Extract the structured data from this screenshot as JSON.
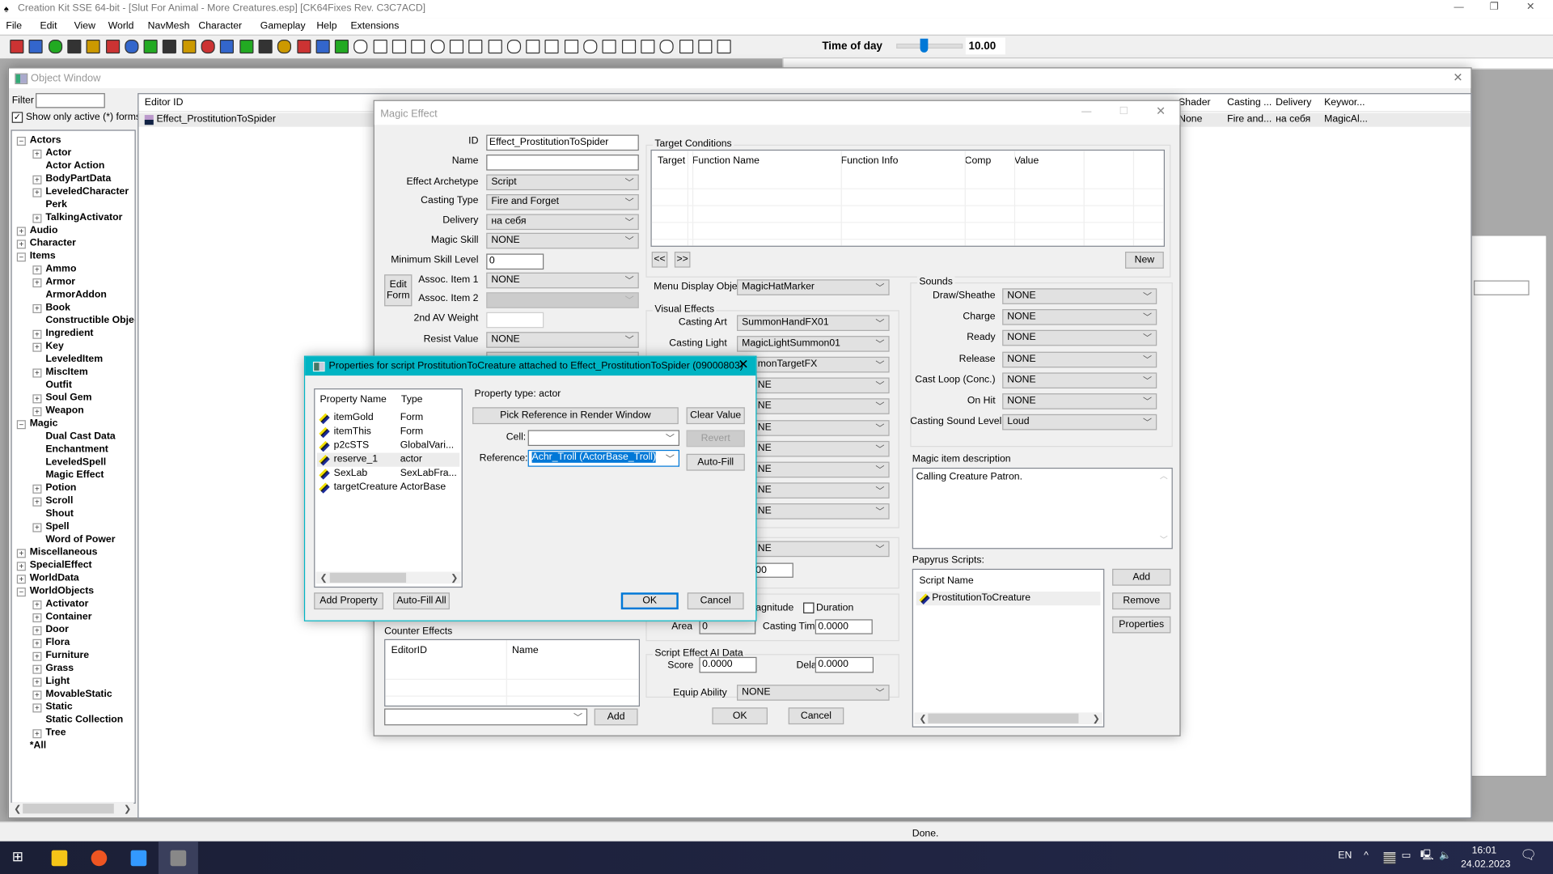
{
  "app": {
    "title": "Creation Kit SSE 64-bit - [Slut For Animal - More Creatures.esp] [CK64Fixes Rev. C3C7ACD]",
    "menu": [
      "File",
      "Edit",
      "View",
      "World",
      "NavMesh",
      "Character",
      "Gameplay",
      "Help",
      "Extensions"
    ],
    "toolbar_icons": [
      "open-icon",
      "save-icon",
      "pc-upload-icon",
      "preferences-icon",
      "undo-icon",
      "redo-icon",
      "render-box-icon",
      "marker-icon",
      "light-marker-icon",
      "world-icon",
      "landscape-icon",
      "havok-icon",
      "fx-icon",
      "bulb-icon",
      "sky-icon",
      "grass-icon",
      "speech-bubble-icon",
      "navmesh-icon",
      "view-box-icon",
      "view-m-icon",
      "view-circle-m-icon",
      "view-0-icon",
      "view-nb-icon",
      "view-h-icon",
      "view-cube-icon",
      "view-p-icon",
      "view-P-icon",
      "view-q-icon",
      "view-x-icon",
      "view-s-icon",
      "light-toggle-icon",
      "view-e-icon",
      "view-c-icon",
      "view-cc-icon",
      "view-circle-c-icon",
      "view-w-icon",
      "view-ww-icon",
      "view-circle-w-icon"
    ],
    "time_of_day_label": "Time of day",
    "time_of_day_value": "10.00",
    "time_of_day_fraction": 0.42,
    "status": "Done."
  },
  "object_window": {
    "title": "Object Window",
    "filter_label": "Filter",
    "filter_value": "",
    "show_active_label": "Show only active (*) forms",
    "show_active_checked": true,
    "tree": [
      {
        "label": "Actors",
        "level": 0,
        "box": "-"
      },
      {
        "label": "Actor",
        "level": 1,
        "box": "+"
      },
      {
        "label": "Actor Action",
        "level": 1,
        "box": ""
      },
      {
        "label": "BodyPartData",
        "level": 1,
        "box": "+"
      },
      {
        "label": "LeveledCharacter",
        "level": 1,
        "box": "+"
      },
      {
        "label": "Perk",
        "level": 1,
        "box": ""
      },
      {
        "label": "TalkingActivator",
        "level": 1,
        "box": "+"
      },
      {
        "label": "Audio",
        "level": 0,
        "box": "+"
      },
      {
        "label": "Character",
        "level": 0,
        "box": "+"
      },
      {
        "label": "Items",
        "level": 0,
        "box": "-"
      },
      {
        "label": "Ammo",
        "level": 1,
        "box": "+"
      },
      {
        "label": "Armor",
        "level": 1,
        "box": "+"
      },
      {
        "label": "ArmorAddon",
        "level": 1,
        "box": ""
      },
      {
        "label": "Book",
        "level": 1,
        "box": "+"
      },
      {
        "label": "Constructible Objec",
        "level": 1,
        "box": ""
      },
      {
        "label": "Ingredient",
        "level": 1,
        "box": "+"
      },
      {
        "label": "Key",
        "level": 1,
        "box": "+"
      },
      {
        "label": "LeveledItem",
        "level": 1,
        "box": ""
      },
      {
        "label": "MiscItem",
        "level": 1,
        "box": "+"
      },
      {
        "label": "Outfit",
        "level": 1,
        "box": ""
      },
      {
        "label": "Soul Gem",
        "level": 1,
        "box": "+"
      },
      {
        "label": "Weapon",
        "level": 1,
        "box": "+"
      },
      {
        "label": "Magic",
        "level": 0,
        "box": "-"
      },
      {
        "label": "Dual Cast Data",
        "level": 1,
        "box": ""
      },
      {
        "label": "Enchantment",
        "level": 1,
        "box": ""
      },
      {
        "label": "LeveledSpell",
        "level": 1,
        "box": ""
      },
      {
        "label": "Magic Effect",
        "level": 1,
        "box": ""
      },
      {
        "label": "Potion",
        "level": 1,
        "box": "+"
      },
      {
        "label": "Scroll",
        "level": 1,
        "box": "+"
      },
      {
        "label": "Shout",
        "level": 1,
        "box": ""
      },
      {
        "label": "Spell",
        "level": 1,
        "box": "+"
      },
      {
        "label": "Word of Power",
        "level": 1,
        "box": ""
      },
      {
        "label": "Miscellaneous",
        "level": 0,
        "box": "+"
      },
      {
        "label": "SpecialEffect",
        "level": 0,
        "box": "+"
      },
      {
        "label": "WorldData",
        "level": 0,
        "box": "+"
      },
      {
        "label": "WorldObjects",
        "level": 0,
        "box": "-"
      },
      {
        "label": "Activator",
        "level": 1,
        "box": "+"
      },
      {
        "label": "Container",
        "level": 1,
        "box": "+"
      },
      {
        "label": "Door",
        "level": 1,
        "box": "+"
      },
      {
        "label": "Flora",
        "level": 1,
        "box": "+"
      },
      {
        "label": "Furniture",
        "level": 1,
        "box": "+"
      },
      {
        "label": "Grass",
        "level": 1,
        "box": "+"
      },
      {
        "label": "Light",
        "level": 1,
        "box": "+"
      },
      {
        "label": "MovableStatic",
        "level": 1,
        "box": "+"
      },
      {
        "label": "Static",
        "level": 1,
        "box": "+"
      },
      {
        "label": "Static Collection",
        "level": 1,
        "box": ""
      },
      {
        "label": "Tree",
        "level": 1,
        "box": "+"
      },
      {
        "label": "*All",
        "level": 0,
        "box": "none"
      }
    ],
    "columns": {
      "editor_id": "Editor ID",
      "shader": "Shader",
      "casting": "Casting ...",
      "delivery": "Delivery",
      "keywords": "Keywor..."
    },
    "row": {
      "editor_id": "Effect_ProstitutionToSpider",
      "shader": "None",
      "casting": "Fire and...",
      "delivery": "на себя",
      "keywords": "MagicAl..."
    }
  },
  "magic_effect": {
    "title": "Magic Effect",
    "id_label": "ID",
    "id_value": "Effect_ProstitutionToSpider",
    "name_label": "Name",
    "name_value": "",
    "archetype_label": "Effect Archetype",
    "archetype_value": "Script",
    "casting_type_label": "Casting Type",
    "casting_type_value": "Fire and Forget",
    "delivery_label": "Delivery",
    "delivery_value": "на себя",
    "magic_skill_label": "Magic Skill",
    "magic_skill_value": "NONE",
    "min_skill_label": "Minimum Skill Level",
    "min_skill_value": "0",
    "edit_form_label": "Edit Form",
    "assoc1_label": "Assoc. Item 1",
    "assoc1_value": "NONE",
    "assoc2_label": "Assoc. Item 2",
    "assoc2_value": "",
    "av_weight_label": "2nd AV Weight",
    "av_weight_value": "",
    "resist_label": "Resist Value",
    "resist_value": "NONE",
    "target_conditions": {
      "label": "Target Conditions",
      "columns": [
        "Target",
        "Function Name",
        "Function Info",
        "Comp",
        "Value"
      ],
      "prev": "<<",
      "next": ">>",
      "new": "New"
    },
    "menu_display_label": "Menu Display Object",
    "menu_display_value": "MagicHatMarker",
    "visual_effects": {
      "label": "Visual Effects",
      "casting_art_label": "Casting Art",
      "casting_art_value": "SummonHandFX01",
      "casting_light_label": "Casting Light",
      "casting_light_value": "MagicLightSummon01",
      "partial_rows": [
        "monTargetFX",
        "NE",
        "NE",
        "NE",
        "NE",
        "NE",
        "NE",
        "NE"
      ]
    },
    "partial_select": "NE",
    "partial_input": "00",
    "magnitude_partial": "agnitude",
    "duration_label": "Duration",
    "duration_checked": false,
    "area_label": "Area",
    "area_value": "0",
    "casting_time_label": "Casting Time",
    "casting_time_value": "0.0000",
    "ai_data": {
      "label": "Script Effect AI Data",
      "score_label": "Score",
      "score_value": "0.0000",
      "delay_label": "Delay Time",
      "delay_value": "0.0000"
    },
    "equip_ability_label": "Equip Ability",
    "equip_ability_value": "NONE",
    "ok": "OK",
    "cancel": "Cancel",
    "counter_effects": {
      "label": "Counter Effects",
      "columns": [
        "EditorID",
        "Name"
      ],
      "add": "Add",
      "combo_value": ""
    },
    "sounds": {
      "label": "Sounds",
      "rows": [
        {
          "label": "Draw/Sheathe",
          "value": "NONE"
        },
        {
          "label": "Charge",
          "value": "NONE"
        },
        {
          "label": "Ready",
          "value": "NONE"
        },
        {
          "label": "Release",
          "value": "NONE"
        },
        {
          "label": "Cast Loop (Conc.)",
          "value": "NONE"
        },
        {
          "label": "On Hit",
          "value": "NONE"
        },
        {
          "label": "Casting Sound Level",
          "value": "Loud"
        }
      ]
    },
    "description_label": "Magic item description",
    "description_value": "Calling Creature Patron.",
    "papyrus": {
      "label": "Papyrus Scripts:",
      "column": "Script Name",
      "scripts": [
        "ProstitutionToCreature"
      ],
      "add": "Add",
      "remove": "Remove",
      "properties": "Properties"
    }
  },
  "properties_dialog": {
    "title": "Properties for script ProstitutionToCreature attached to Effect_ProstitutionToSpider (09000803)",
    "columns": [
      "Property Name",
      "Type"
    ],
    "properties": [
      {
        "name": "itemGold",
        "type": "Form"
      },
      {
        "name": "itemThis",
        "type": "Form"
      },
      {
        "name": "p2cSTS",
        "type": "GlobalVari..."
      },
      {
        "name": "reserve_1",
        "type": "actor",
        "selected": true
      },
      {
        "name": "SexLab",
        "type": "SexLabFra..."
      },
      {
        "name": "targetCreature",
        "type": "ActorBase"
      }
    ],
    "property_type": "Property type: actor",
    "pick_reference": "Pick Reference in Render Window",
    "clear_value": "Clear Value",
    "cell_label": "Cell:",
    "cell_value": "",
    "revert": "Revert",
    "reference_label": "Reference:",
    "reference_value": "Achr_Troll (ActorBase_Troll)",
    "auto_fill": "Auto-Fill",
    "add_property": "Add Property",
    "auto_fill_all": "Auto-Fill All",
    "ok": "OK",
    "cancel": "Cancel",
    "title_color": "#00b4c3"
  },
  "taskbar": {
    "lang": "EN",
    "time": "16:01",
    "date": "24.02.2023",
    "apps": [
      "file-explorer-icon",
      "yandex-browser-icon",
      "app-icon",
      "creation-kit-icon"
    ]
  }
}
